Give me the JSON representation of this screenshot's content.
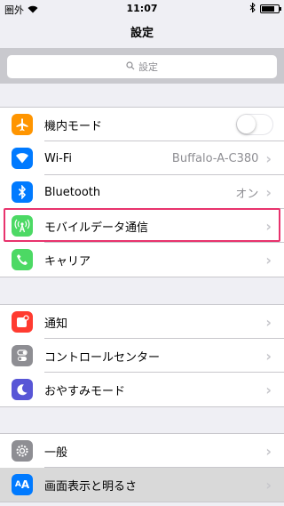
{
  "status": {
    "carrier": "圏外",
    "time": "11:07"
  },
  "nav": {
    "title": "設定"
  },
  "search": {
    "placeholder": "設定"
  },
  "groups": [
    {
      "rows": [
        {
          "label": "機内モード",
          "icon": "airplane-icon",
          "color": "#ff9500",
          "control": "toggle",
          "toggle_on": false
        },
        {
          "label": "Wi-Fi",
          "icon": "wifi-icon",
          "color": "#007aff",
          "detail": "Buffalo-A-C380"
        },
        {
          "label": "Bluetooth",
          "icon": "bluetooth-icon",
          "color": "#007aff",
          "detail": "オン"
        },
        {
          "label": "モバイルデータ通信",
          "icon": "cellular-antenna-icon",
          "color": "#4cd964",
          "highlighted": true
        },
        {
          "label": "キャリア",
          "icon": "phone-icon",
          "color": "#4cd964"
        }
      ]
    },
    {
      "rows": [
        {
          "label": "通知",
          "icon": "notifications-icon",
          "color": "#ff3b30"
        },
        {
          "label": "コントロールセンター",
          "icon": "control-center-icon",
          "color": "#8e8e93"
        },
        {
          "label": "おやすみモード",
          "icon": "moon-icon",
          "color": "#5856d6"
        }
      ]
    },
    {
      "rows": [
        {
          "label": "一般",
          "icon": "gear-icon",
          "color": "#8e8e93"
        },
        {
          "label": "画面表示と明るさ",
          "icon": "text-size-icon",
          "color": "#007aff",
          "selected": true
        }
      ]
    }
  ],
  "colors": {
    "highlight_border": "#e8336d",
    "background": "#efeff4"
  }
}
